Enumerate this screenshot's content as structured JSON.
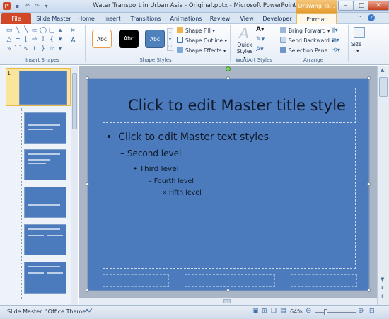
{
  "window": {
    "title": "Water Transport in Urban Asia - Original.pptx - Microsoft PowerPoint",
    "contextual_tab_title": "Drawing To...",
    "app_logo": "P",
    "controls": {
      "minimize": "–",
      "maximize": "□",
      "close": "✕"
    }
  },
  "quick_access": [
    {
      "name": "save-icon",
      "glyph": "▪"
    },
    {
      "name": "undo-icon",
      "glyph": "↶"
    },
    {
      "name": "redo-icon",
      "glyph": "↷"
    },
    {
      "name": "customize-qat-icon",
      "glyph": "▾"
    }
  ],
  "tabs": [
    {
      "label": "File",
      "active": false
    },
    {
      "label": "Slide Master"
    },
    {
      "label": "Home"
    },
    {
      "label": "Insert"
    },
    {
      "label": "Transitions"
    },
    {
      "label": "Animations"
    },
    {
      "label": "Review"
    },
    {
      "label": "View"
    },
    {
      "label": "Developer"
    },
    {
      "label": "Format",
      "active": true
    }
  ],
  "ribbon": {
    "insert_shapes": {
      "label": "Insert Shapes"
    },
    "shape_styles": {
      "label": "Shape Styles",
      "swatches": [
        {
          "text": "Abc"
        },
        {
          "text": "Abc"
        },
        {
          "text": "Abc"
        }
      ],
      "fill": "Shape Fill",
      "outline": "Shape Outline",
      "effects": "Shape Effects"
    },
    "wordart": {
      "label": "WordArt Styles",
      "quick_styles": "Quick Styles",
      "quick_styles_l1": "Quick",
      "quick_styles_l2": "Styles",
      "a_glyph": "A"
    },
    "arrange": {
      "label": "Arrange",
      "bring_forward": "Bring Forward",
      "send_backward": "Send Backward",
      "selection_pane": "Selection Pane"
    },
    "size": {
      "label": "Size"
    }
  },
  "thumbnails": {
    "selected_number": "1"
  },
  "slide": {
    "title": "Click to edit Master title style",
    "levels": [
      {
        "bullet": "•",
        "text": "Click to edit Master text styles"
      },
      {
        "bullet": "–",
        "text": "Second level"
      },
      {
        "bullet": "•",
        "text": "Third level"
      },
      {
        "bullet": "–",
        "text": "Fourth level"
      },
      {
        "bullet": "»",
        "text": "Fifth level"
      }
    ]
  },
  "statusbar": {
    "view": "Slide Master",
    "theme": "\"Office Theme\"",
    "zoom": "64%"
  },
  "colors": {
    "slide_bg": "#4b7bbd",
    "file_tab": "#d24726",
    "contextual": "#e59b2f"
  }
}
